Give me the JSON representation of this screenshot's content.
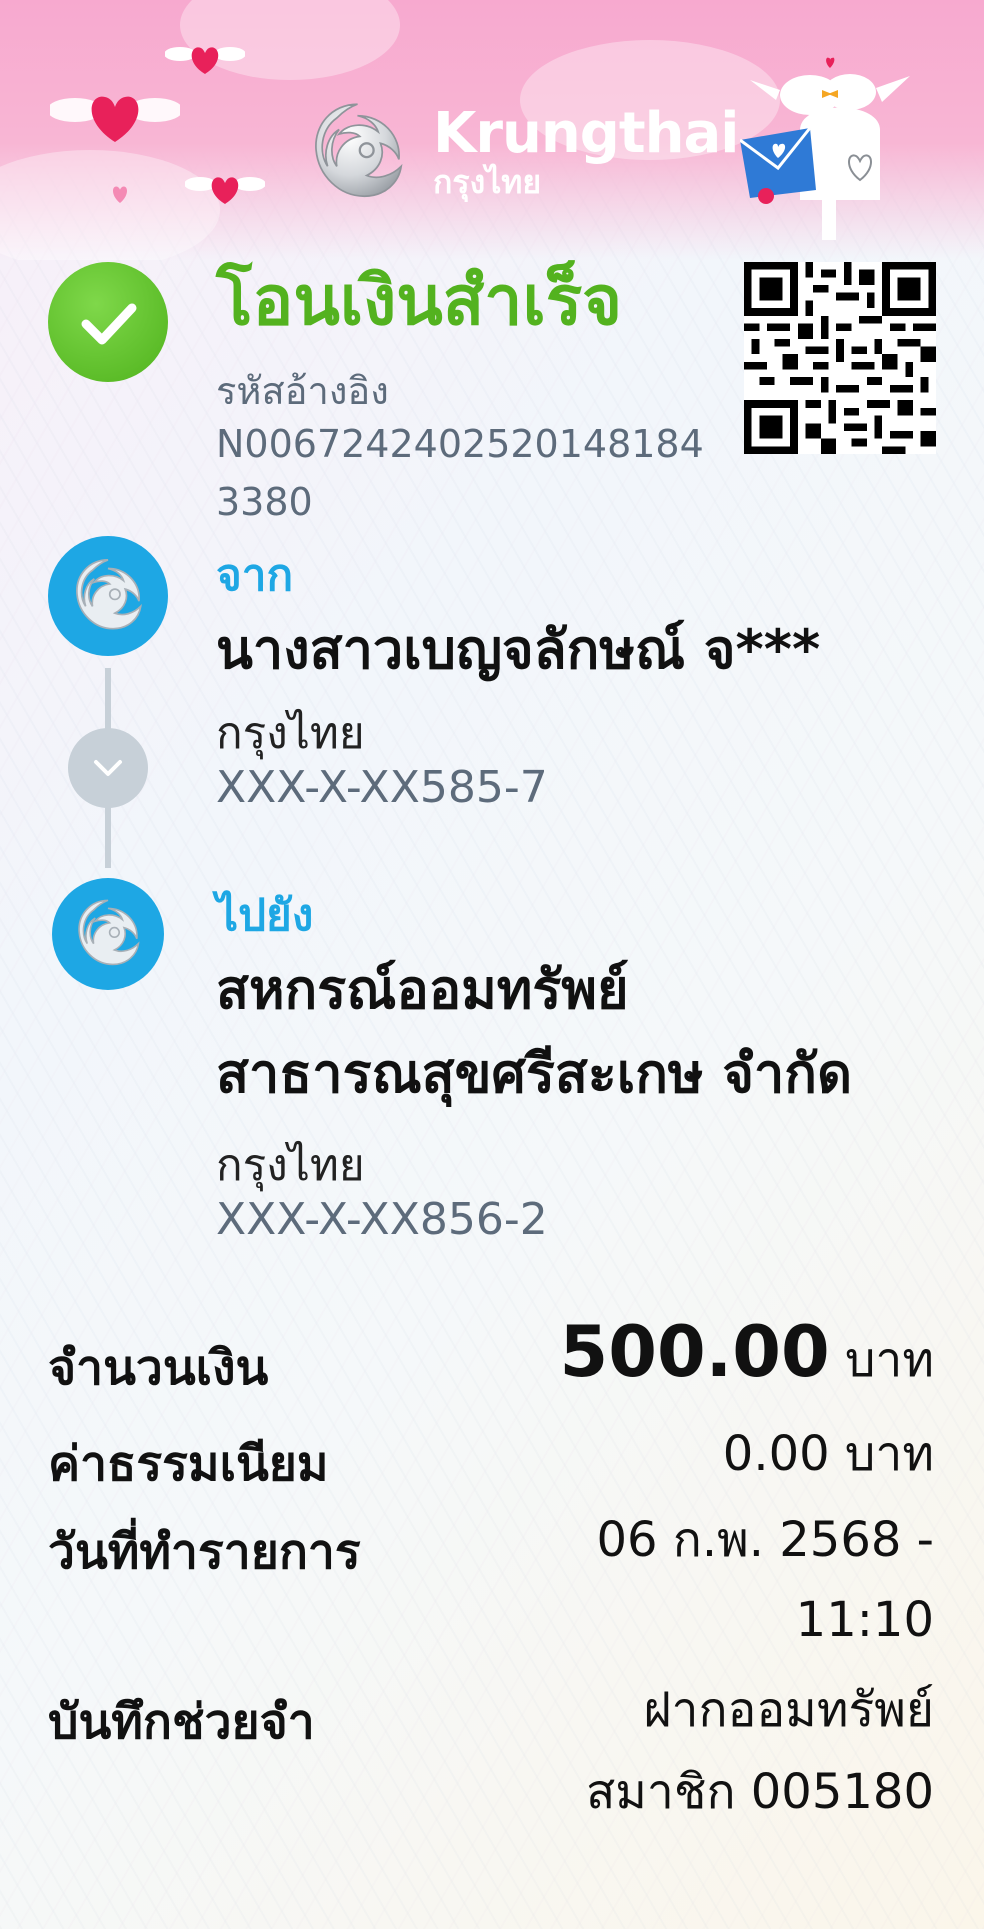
{
  "brand": {
    "name_en": "Krungthai",
    "name_th": "กรุงไทย"
  },
  "status": {
    "title": "โอนเงินสำเร็จ",
    "ref_label": "รหัสอ้างอิง",
    "ref_value": "N00672424025201481843380"
  },
  "from": {
    "label": "จาก",
    "name": "นางสาวเบญจลักษณ์ จ***",
    "bank": "กรุงไทย",
    "account": "XXX-X-XX585-7"
  },
  "to": {
    "label": "ไปยัง",
    "name_line1": "สหกรณ์ออมทรัพย์",
    "name_line2": "สาธารณสุขศรีสะเกษ จำกัด",
    "bank": "กรุงไทย",
    "account": "XXX-X-XX856-2"
  },
  "details": {
    "amount_label": "จำนวนเงิน",
    "amount_value": "500.00",
    "amount_unit": "บาท",
    "fee_label": "ค่าธรรมเนียม",
    "fee_value": "0.00 บาท",
    "date_label": "วันที่ทำรายการ",
    "date_line1": "06 ก.พ. 2568 -",
    "date_line2": "11:10",
    "memo_label": "บันทึกช่วยจำ",
    "memo_line1": "ฝากออมทรัพย์",
    "memo_line2": "สมาชิก 005180"
  },
  "colors": {
    "success": "#53b21f",
    "accent": "#1ea7e4",
    "muted": "#5d6b7b",
    "header_pink": "#f7a9cf"
  },
  "icons": [
    "check-icon",
    "krungthai-bird-icon",
    "chevron-down-icon",
    "qr-code",
    "heart-icon",
    "dove-mailbox-illustration"
  ]
}
